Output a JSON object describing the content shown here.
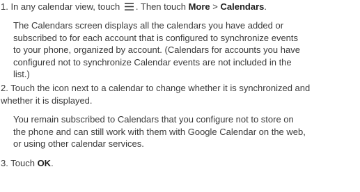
{
  "step1": {
    "number": "1.",
    "text_before": "In any calendar view, touch",
    "icon": "menu-icon",
    "text_mid": ". Then touch",
    "more_label": "More",
    "separator": ">",
    "calendars_label": "Calendars",
    "text_end": ".",
    "note_lines": [
      "The Calendars screen displays all the calendars you have added or",
      "subscribed to for each account that is configured to synchronize events",
      "to your phone, organized by account. (Calendars for accounts you have",
      "configured not to synchronize Calendar events are not included in the",
      "list.)"
    ]
  },
  "step2": {
    "number": "2.",
    "lines": [
      "Touch the icon next to a calendar to change whether it is synchronized and",
      "whether it is displayed."
    ],
    "note_lines": [
      "You remain subscribed to Calendars that you configure not to store on",
      "the phone and can still work with them with Google Calendar on the web,",
      "or using other calendar services."
    ]
  },
  "step3": {
    "number": "3.",
    "text_before": "Touch",
    "ok_label": "OK",
    "text_end": "."
  }
}
